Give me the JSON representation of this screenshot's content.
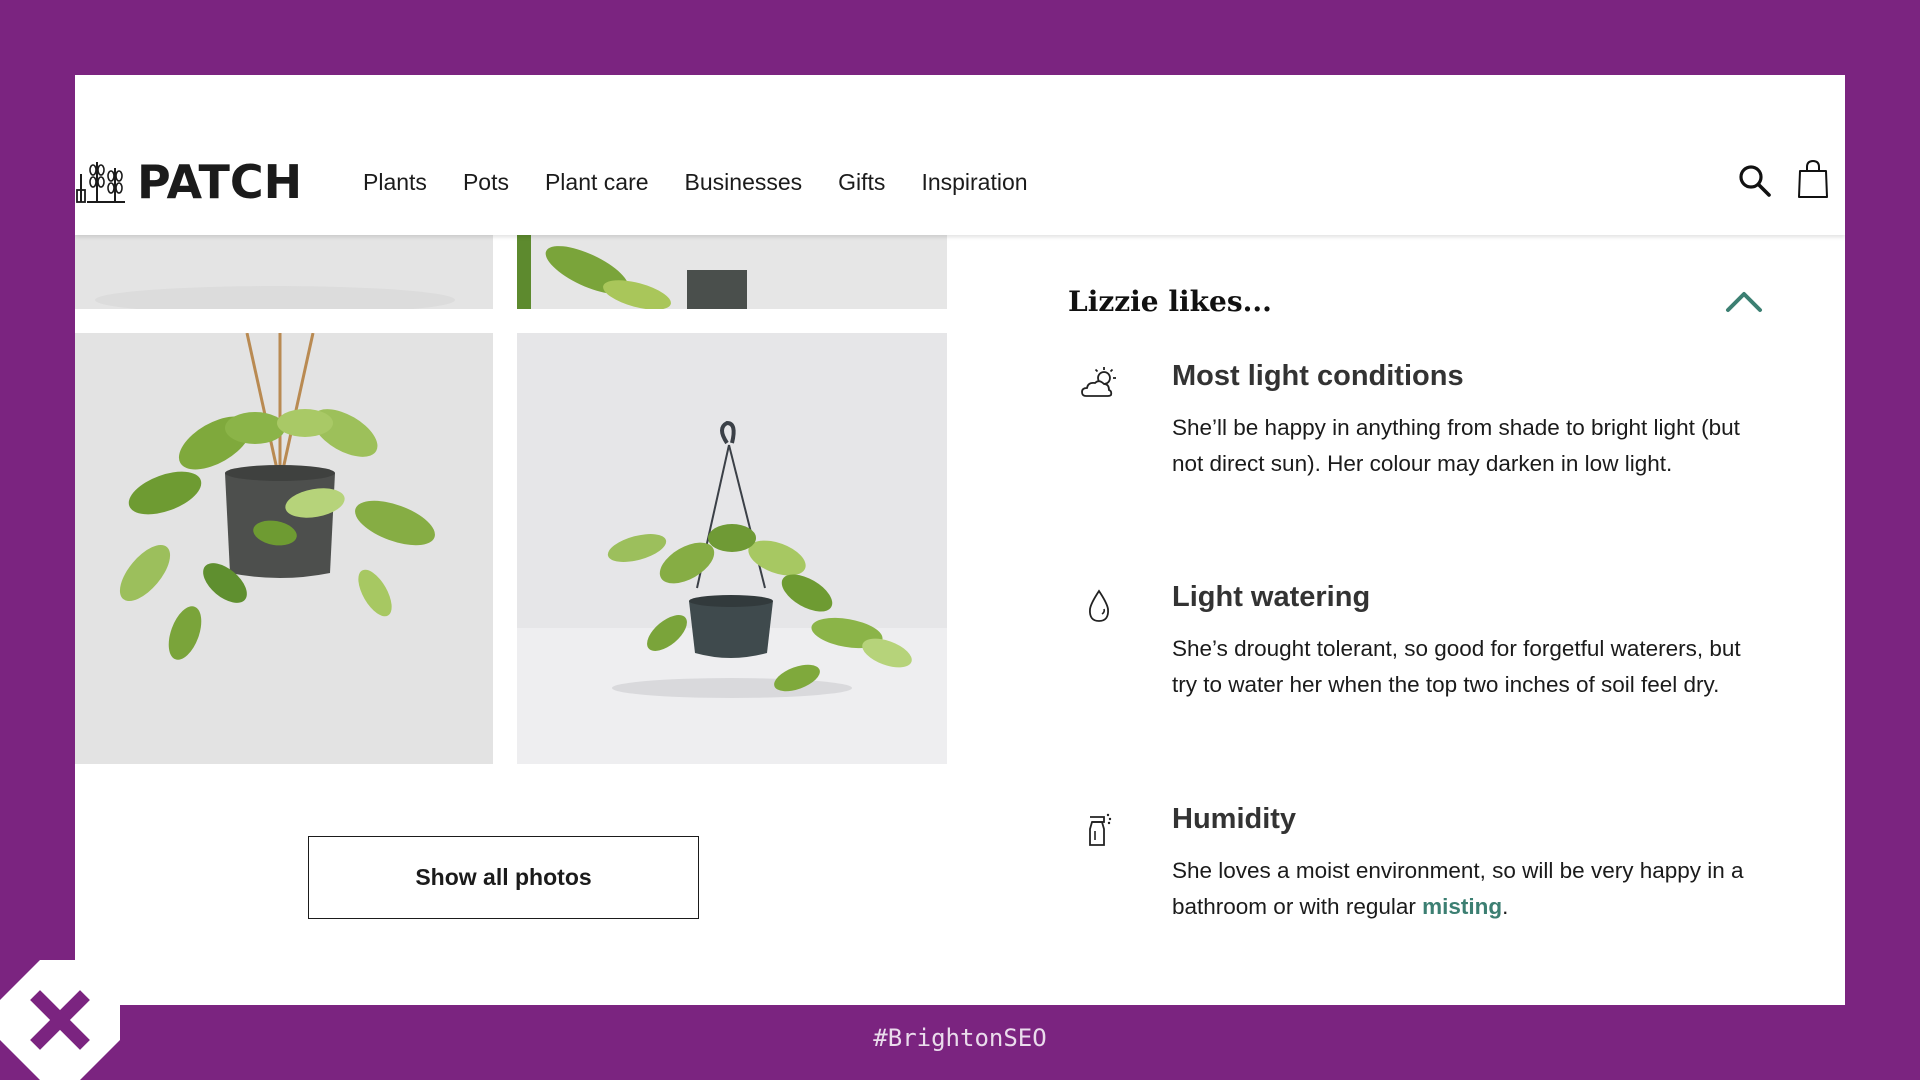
{
  "header": {
    "logo_text": "PATCH",
    "nav": [
      "Plants",
      "Pots",
      "Plant care",
      "Businesses",
      "Gifts",
      "Inspiration"
    ],
    "icons": {
      "search": "search-icon",
      "bag": "shopping-bag-icon"
    }
  },
  "gallery": {
    "show_all_label": "Show all photos"
  },
  "likes": {
    "title": "Lizzie likes...",
    "toggle_icon": "chevron-up-icon",
    "items": [
      {
        "icon": "sun-cloud-icon",
        "heading": "Most light conditions",
        "body": "She’ll be happy in anything from shade to bright light (but not direct sun). Her colour may darken in low light."
      },
      {
        "icon": "water-drop-icon",
        "heading": "Light watering",
        "body": "She’s drought tolerant, so good for forgetful waterers, but try to water her when the top two inches of soil feel dry."
      },
      {
        "icon": "spray-bottle-icon",
        "heading": "Humidity",
        "body_before": "She loves a moist environment, so will be very happy in a bathroom or with regular ",
        "link": "misting",
        "body_after": "."
      }
    ]
  },
  "footer": {
    "hashtag": "#BrightonSEO"
  },
  "colors": {
    "background": "#7b2480",
    "accent": "#3c7f72",
    "text": "#1b1b1b"
  }
}
